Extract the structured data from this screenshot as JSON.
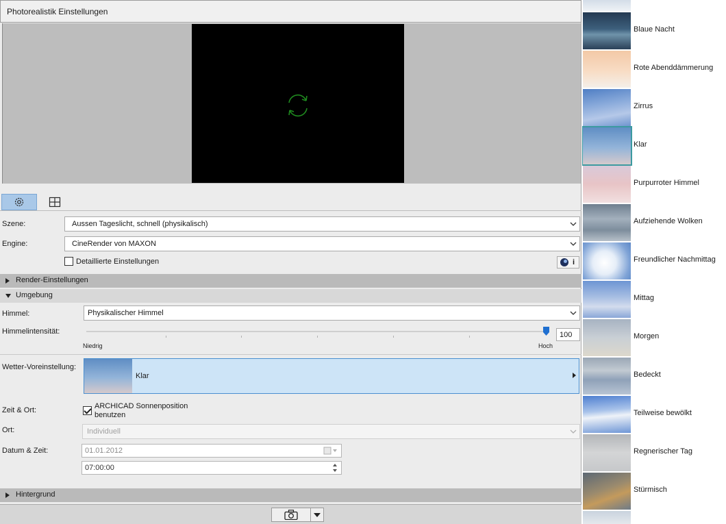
{
  "window": {
    "title": "Photorealistik Einstellungen"
  },
  "tabs": {
    "settings_icon": "gear-icon",
    "layout_icon": "grid-icon"
  },
  "preview": {
    "spinner_icon": "refresh-icon",
    "spinner_color": "#1f8a1f"
  },
  "scene": {
    "label": "Szene:",
    "value": "Aussen Tageslicht, schnell (physikalisch)"
  },
  "engine": {
    "label": "Engine:",
    "value": "CineRender von MAXON"
  },
  "detailed": {
    "label": "Detaillierte Einstellungen",
    "checked": false
  },
  "sections": {
    "render": "Render-Einstellungen",
    "environment": "Umgebung",
    "background": "Hintergrund"
  },
  "sky": {
    "label": "Himmel:",
    "value": "Physikalischer Himmel"
  },
  "intensity": {
    "label": "Himmelintensität:",
    "low": "Niedrig",
    "high": "Hoch",
    "value": "100",
    "fraction": 1.0
  },
  "weather": {
    "label": "Wetter-Voreinstellung:",
    "value": "Klar"
  },
  "time_location": {
    "label": "Zeit & Ort:",
    "sun_checkbox": "ARCHICAD Sonnenposition",
    "sun_checkbox_2": "benutzen",
    "checked": true
  },
  "location": {
    "label": "Ort:",
    "value": "Individuell"
  },
  "datetime": {
    "label": "Datum & Zeit:",
    "date": "01.01.2012",
    "time": "07:00:00"
  },
  "accent_color": "#4a8fd0",
  "sky_presets": [
    {
      "name": "Blaue Nacht",
      "selected": false
    },
    {
      "name": "Rote Abenddämmerung",
      "selected": false
    },
    {
      "name": "Zirrus",
      "selected": false
    },
    {
      "name": "Klar",
      "selected": true
    },
    {
      "name": "Purpurroter Himmel",
      "selected": false
    },
    {
      "name": "Aufziehende Wolken",
      "selected": false
    },
    {
      "name": "Freundlicher Nachmittag",
      "selected": false
    },
    {
      "name": "Mittag",
      "selected": false
    },
    {
      "name": "Morgen",
      "selected": false
    },
    {
      "name": "Bedeckt",
      "selected": false
    },
    {
      "name": "Teilweise bewölkt",
      "selected": false
    },
    {
      "name": "Regnerischer Tag",
      "selected": false
    },
    {
      "name": "Stürmisch",
      "selected": false
    }
  ]
}
